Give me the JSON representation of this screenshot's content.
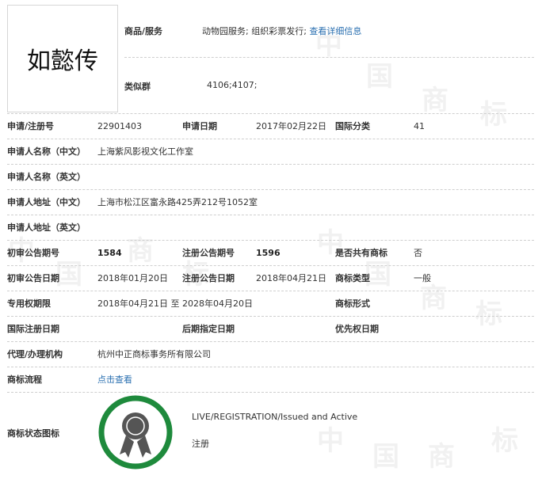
{
  "mark_name": "如懿传",
  "goods": {
    "label": "商品/服务",
    "value": "动物园服务; 组织彩票发行;",
    "link": "查看详细信息"
  },
  "similar_group": {
    "label": "类似群",
    "value": "4106;4107;"
  },
  "rows": {
    "reg_no": {
      "label": "申请/注册号",
      "value": "22901403"
    },
    "app_date": {
      "label": "申请日期",
      "value": "2017年02月22日"
    },
    "intl_class": {
      "label": "国际分类",
      "value": "41"
    },
    "applicant_cn": {
      "label": "申请人名称（中文）",
      "value": "上海紫风影视文化工作室"
    },
    "applicant_en": {
      "label": "申请人名称（英文）",
      "value": ""
    },
    "address_cn": {
      "label": "申请人地址（中文）",
      "value": "上海市松江区富永路425弄212号1052室"
    },
    "address_en": {
      "label": "申请人地址（英文）",
      "value": ""
    },
    "prelim_issue": {
      "label": "初审公告期号",
      "value": "1584"
    },
    "reg_issue": {
      "label": "注册公告期号",
      "value": "1596"
    },
    "shared": {
      "label": "是否共有商标",
      "value": "否"
    },
    "prelim_date": {
      "label": "初审公告日期",
      "value": "2018年01月20日"
    },
    "reg_date": {
      "label": "注册公告日期",
      "value": "2018年04月21日"
    },
    "mark_type": {
      "label": "商标类型",
      "value": "一般"
    },
    "exclusive": {
      "label": "专用权期限",
      "value": "2018年04月21日 至 2028年04月20日"
    },
    "mark_form": {
      "label": "商标形式",
      "value": ""
    },
    "intl_reg_date": {
      "label": "国际注册日期",
      "value": ""
    },
    "later_date": {
      "label": "后期指定日期",
      "value": ""
    },
    "priority_date": {
      "label": "优先权日期",
      "value": ""
    },
    "agent": {
      "label": "代理/办理机构",
      "value": "杭州中正商标事务所有限公司"
    },
    "process": {
      "label": "商标流程",
      "link": "点击查看"
    }
  },
  "status": {
    "label": "商标状态图标",
    "text_en": "LIVE/REGISTRATION/Issued and Active",
    "text_cn": "注册",
    "badge_ring_color": "#1e8a3c",
    "badge_icon_color": "#555555"
  },
  "watermark": [
    "中",
    "国",
    "商",
    "标"
  ]
}
